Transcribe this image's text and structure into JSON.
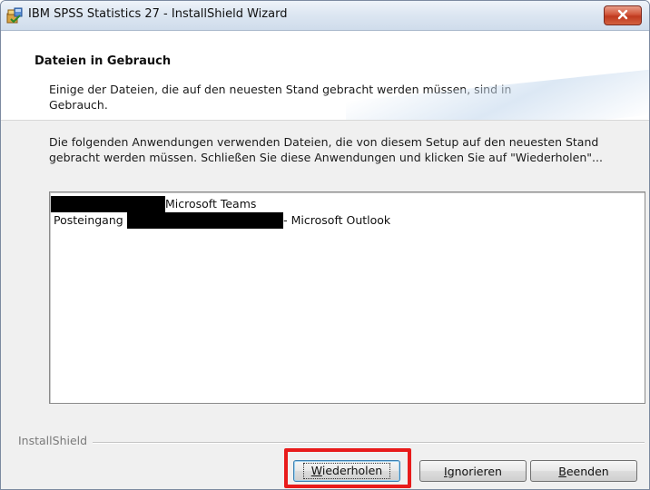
{
  "window": {
    "title": "IBM SPSS Statistics 27 - InstallShield Wizard",
    "icon": "installer-icon",
    "close_icon": "close-icon"
  },
  "header": {
    "title": "Dateien in Gebrauch",
    "description": "Einige der Dateien, die auf den neuesten Stand gebracht werden müssen, sind in Gebrauch."
  },
  "body": {
    "description": "Die folgenden Anwendungen verwenden Dateien, die von diesem Setup auf den neuesten Stand gebracht werden müssen. Schließen Sie diese Anwendungen und klicken Sie auf \"Wiederholen\"..."
  },
  "applications": [
    {
      "prefix": "",
      "suffix": "Microsoft Teams"
    },
    {
      "prefix": "Posteingang - ",
      "suffix": "- Microsoft Outlook"
    }
  ],
  "footer": {
    "brand": "InstallShield"
  },
  "buttons": {
    "retry": {
      "accel": "W",
      "rest": "iederholen"
    },
    "ignore": {
      "accel": "I",
      "rest": "gnorieren"
    },
    "exit": {
      "accel": "B",
      "rest": "eenden"
    }
  },
  "colors": {
    "highlight": "#e81b1b",
    "close_button": "#c0391f"
  }
}
